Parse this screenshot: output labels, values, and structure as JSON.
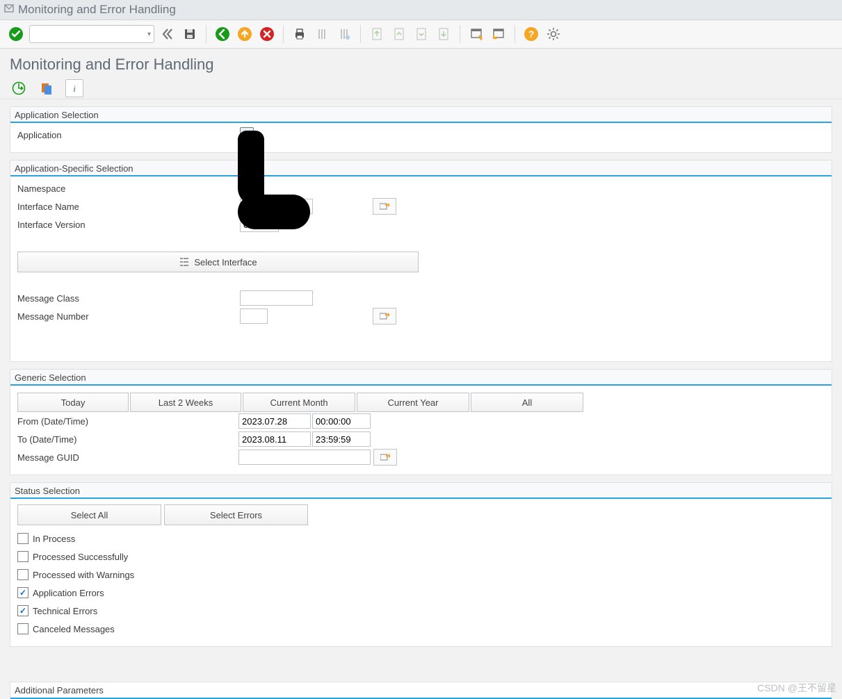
{
  "window": {
    "title": "Monitoring and Error Handling"
  },
  "page": {
    "title": "Monitoring and Error Handling"
  },
  "sections": {
    "app_sel": {
      "header": "Application Selection",
      "application_label": "Application"
    },
    "app_spec": {
      "header": "Application-Specific Selection",
      "namespace_label": "Namespace",
      "ifname_label": "Interface Name",
      "ifver_label": "Interface Version",
      "ifver_value": "01",
      "select_interface_btn": "Select Interface",
      "msg_class_label": "Message Class",
      "msg_num_label": "Message Number"
    },
    "generic": {
      "header": "Generic Selection",
      "quick": {
        "today": "Today",
        "last2w": "Last 2 Weeks",
        "cur_month": "Current Month",
        "cur_year": "Current Year",
        "all": "All"
      },
      "from_label": "From (Date/Time)",
      "to_label": "To (Date/Time)",
      "guid_label": "Message GUID",
      "from_date": "2023.07.28",
      "from_time": "00:00:00",
      "to_date": "2023.08.11",
      "to_time": "23:59:59"
    },
    "status": {
      "header": "Status Selection",
      "select_all_btn": "Select All",
      "select_errors_btn": "Select Errors",
      "items": {
        "in_process": "In Process",
        "proc_ok": "Processed Successfully",
        "proc_warn": "Processed with Warnings",
        "app_err": "Application Errors",
        "tech_err": "Technical Errors",
        "cancel_msg": "Canceled Messages"
      },
      "checked": {
        "in_process": false,
        "proc_ok": false,
        "proc_warn": false,
        "app_err": true,
        "tech_err": true,
        "cancel_msg": false
      }
    },
    "additional": {
      "header": "Additional Parameters"
    }
  },
  "watermark": "CSDN @王不留星"
}
